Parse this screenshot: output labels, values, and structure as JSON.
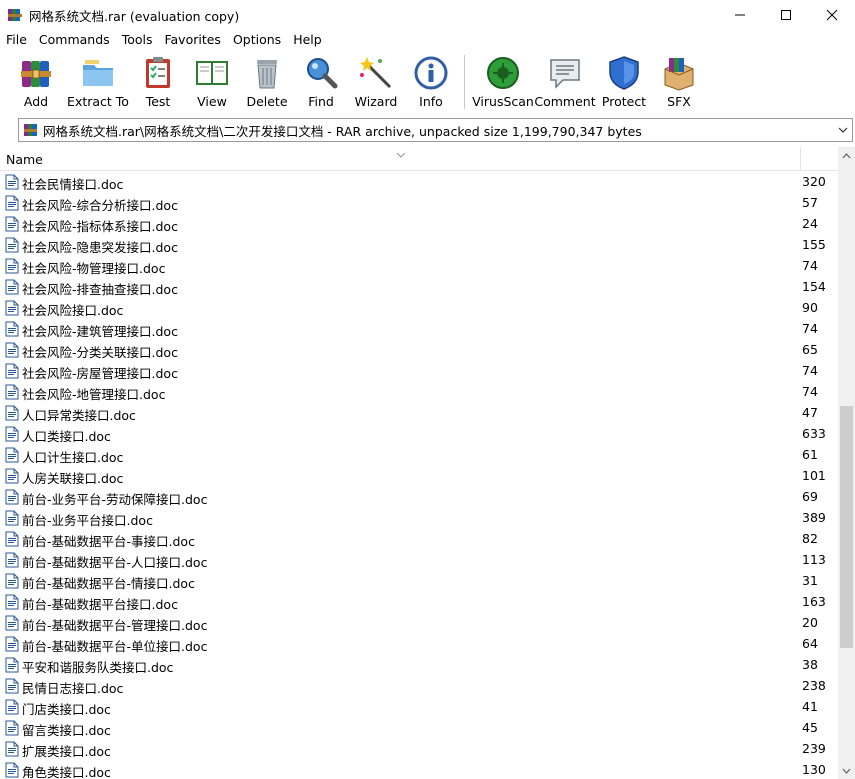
{
  "window": {
    "title": "网格系统文档.rar (evaluation copy)"
  },
  "menu": [
    "File",
    "Commands",
    "Tools",
    "Favorites",
    "Options",
    "Help"
  ],
  "toolbar": {
    "add": "Add",
    "extract_to": "Extract To",
    "test": "Test",
    "view": "View",
    "delete": "Delete",
    "find": "Find",
    "wizard": "Wizard",
    "info": "Info",
    "virusscan": "VirusScan",
    "comment": "Comment",
    "protect": "Protect",
    "sfx": "SFX"
  },
  "address": {
    "path": "网格系统文档.rar\\网格系统文档\\二次开发接口文档 - RAR archive, unpacked size 1,199,790,347 bytes"
  },
  "list": {
    "column_name": "Name",
    "files": [
      {
        "name": "社会民情接口.doc",
        "size": "320"
      },
      {
        "name": "社会风险-综合分析接口.doc",
        "size": "57"
      },
      {
        "name": "社会风险-指标体系接口.doc",
        "size": "24"
      },
      {
        "name": "社会风险-隐患突发接口.doc",
        "size": "155"
      },
      {
        "name": "社会风险-物管理接口.doc",
        "size": "74"
      },
      {
        "name": "社会风险-排查抽查接口.doc",
        "size": "154"
      },
      {
        "name": "社会风险接口.doc",
        "size": "90"
      },
      {
        "name": "社会风险-建筑管理接口.doc",
        "size": "74"
      },
      {
        "name": "社会风险-分类关联接口.doc",
        "size": "65"
      },
      {
        "name": "社会风险-房屋管理接口.doc",
        "size": "74"
      },
      {
        "name": "社会风险-地管理接口.doc",
        "size": "74"
      },
      {
        "name": "人口异常类接口.doc",
        "size": "47"
      },
      {
        "name": "人口类接口.doc",
        "size": "633"
      },
      {
        "name": "人口计生接口.doc",
        "size": "61"
      },
      {
        "name": "人房关联接口.doc",
        "size": "101"
      },
      {
        "name": "前台-业务平台-劳动保障接口.doc",
        "size": "69"
      },
      {
        "name": "前台-业务平台接口.doc",
        "size": "389"
      },
      {
        "name": "前台-基础数据平台-事接口.doc",
        "size": "82"
      },
      {
        "name": "前台-基础数据平台-人口接口.doc",
        "size": "113"
      },
      {
        "name": "前台-基础数据平台-情接口.doc",
        "size": "31"
      },
      {
        "name": "前台-基础数据平台接口.doc",
        "size": "163"
      },
      {
        "name": "前台-基础数据平台-管理接口.doc",
        "size": "20"
      },
      {
        "name": "前台-基础数据平台-单位接口.doc",
        "size": "64"
      },
      {
        "name": "平安和谐服务队类接口.doc",
        "size": "38"
      },
      {
        "name": "民情日志接口.doc",
        "size": "238"
      },
      {
        "name": "门店类接口.doc",
        "size": "41"
      },
      {
        "name": "留言类接口.doc",
        "size": "45"
      },
      {
        "name": "扩展类接口.doc",
        "size": "239"
      },
      {
        "name": "角色类接口.doc",
        "size": "130"
      }
    ]
  }
}
